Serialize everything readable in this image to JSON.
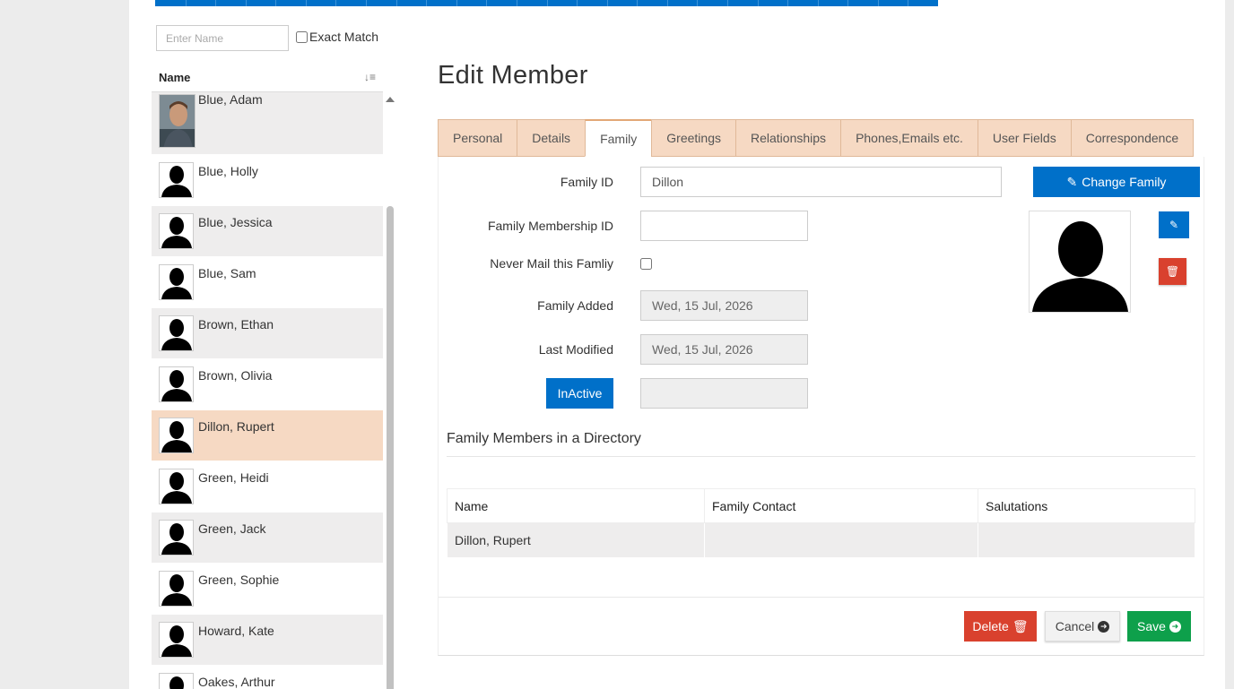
{
  "search": {
    "placeholder": "Enter Name",
    "exact_match_label": "Exact Match"
  },
  "list": {
    "header": "Name",
    "members": [
      {
        "name": "Blue, Adam",
        "photo": "adam-photo"
      },
      {
        "name": "Blue, Holly"
      },
      {
        "name": "Blue, Jessica"
      },
      {
        "name": "Blue, Sam"
      },
      {
        "name": "Brown, Ethan"
      },
      {
        "name": "Brown, Olivia"
      },
      {
        "name": "Dillon, Rupert",
        "selected": true
      },
      {
        "name": "Green, Heidi"
      },
      {
        "name": "Green, Jack"
      },
      {
        "name": "Green, Sophie"
      },
      {
        "name": "Howard, Kate"
      },
      {
        "name": "Oakes, Arthur"
      }
    ]
  },
  "page": {
    "title": "Edit Member"
  },
  "tabs": [
    {
      "label": "Personal"
    },
    {
      "label": "Details"
    },
    {
      "label": "Family",
      "active": true
    },
    {
      "label": "Greetings"
    },
    {
      "label": "Relationships"
    },
    {
      "label": "Phones,Emails etc."
    },
    {
      "label": "User Fields"
    },
    {
      "label": "Correspondence"
    }
  ],
  "family": {
    "family_id_label": "Family ID",
    "family_id_value": "Dillon",
    "membership_id_label": "Family Membership ID",
    "membership_id_value": "",
    "never_mail_label": "Never Mail this Famliy",
    "family_added_label": "Family Added",
    "family_added_value": "Wed, 15 Jul, 2026",
    "last_modified_label": "Last Modified",
    "last_modified_value": "Wed, 15 Jul, 2026",
    "inactive_button": "InActive",
    "inactive_value": "",
    "change_family_button": "Change Family"
  },
  "directory": {
    "heading": "Family Members in a Directory",
    "columns": [
      "Name",
      "Family Contact",
      "Salutations"
    ],
    "rows": [
      [
        "Dillon, Rupert",
        "",
        ""
      ]
    ]
  },
  "footer": {
    "delete": "Delete",
    "cancel": "Cancel",
    "save": "Save"
  },
  "colors": {
    "primary": "#0070c9",
    "danger": "#d9412e",
    "success": "#0ea04b",
    "tab_bg": "#f6d9c3",
    "selected_row": "#f6d9c3"
  }
}
